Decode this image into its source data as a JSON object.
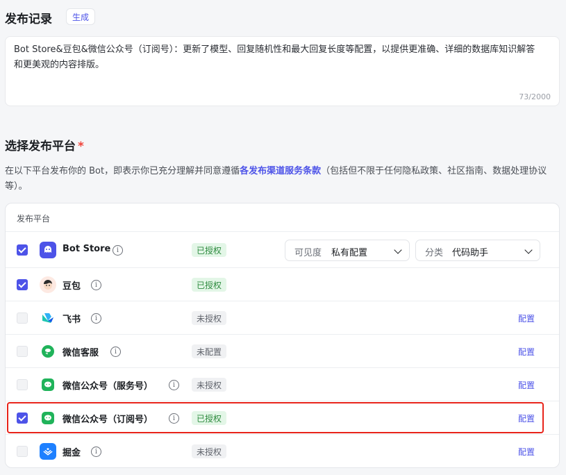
{
  "release": {
    "title": "发布记录",
    "generate_label": "生成",
    "notes": "Bot Store&豆包&微信公众号（订阅号）：更新了模型、回复随机性和最大回复长度等配置，以提供更准确、详细的数据库知识解答和更美观的内容排版。",
    "counter": "73/2000"
  },
  "platform_section": {
    "title": "选择发布平台",
    "required_mark": "*",
    "desc_before": "在以下平台发布你的 Bot，即表示你已充分理解并同意遵循",
    "desc_link": "各发布渠道服务条款",
    "desc_after": "（包括但不限于任何隐私政策、社区指南、数据处理协议等）。",
    "column_header": "发布平台"
  },
  "platforms": [
    {
      "name": "Bot Store",
      "checked": true,
      "status": "已授权",
      "status_type": "ok",
      "icon": "bot-store-icon"
    },
    {
      "name": "豆包",
      "checked": true,
      "status": "已授权",
      "status_type": "ok",
      "icon": "doubao-icon"
    },
    {
      "name": "飞书",
      "checked": false,
      "status": "未授权",
      "status_type": "no",
      "config": "配置",
      "icon": "feishu-icon"
    },
    {
      "name": "微信客服",
      "checked": false,
      "status": "未配置",
      "status_type": "no",
      "config": "配置",
      "icon": "wechat-icon"
    },
    {
      "name": "微信公众号（服务号）",
      "checked": false,
      "status": "未授权",
      "status_type": "no",
      "config": "配置",
      "icon": "wechat-icon"
    },
    {
      "name": "微信公众号（订阅号）",
      "checked": true,
      "status": "已授权",
      "status_type": "ok",
      "config": "配置",
      "icon": "wechat-icon"
    },
    {
      "name": "掘金",
      "checked": false,
      "status": "未授权",
      "status_type": "no",
      "config": "配置",
      "icon": "juejin-icon"
    }
  ],
  "bot_store_options": {
    "visibility_label": "可见度",
    "visibility_value": "私有配置",
    "category_label": "分类",
    "category_value": "代码助手"
  },
  "colors": {
    "accent": "#4d53e8",
    "highlight": "#e8241a",
    "wechat_green": "#20b35a",
    "juejin_blue": "#1e80ff"
  }
}
